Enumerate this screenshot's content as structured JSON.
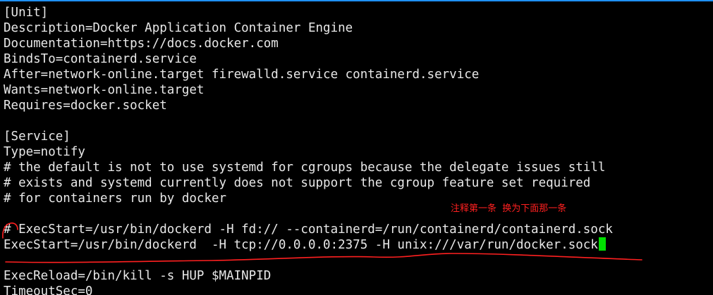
{
  "terminal": {
    "lines": [
      "[Unit]",
      "Description=Docker Application Container Engine",
      "Documentation=https://docs.docker.com",
      "BindsTo=containerd.service",
      "After=network-online.target firewalld.service containerd.service",
      "Wants=network-online.target",
      "Requires=docker.socket",
      "",
      "[Service]",
      "Type=notify",
      "# the default is not to use systemd for cgroups because the delegate issues still",
      "# exists and systemd currently does not support the cgroup feature set required",
      "# for containers run by docker",
      "",
      "# ExecStart=/usr/bin/dockerd -H fd:// --containerd=/run/containerd/containerd.sock",
      "ExecStart=/usr/bin/dockerd  -H tcp://0.0.0.0:2375 -H unix:///var/run/docker.sock",
      "",
      "ExecReload=/bin/kill -s HUP $MAINPID",
      "TimeoutSec=0"
    ],
    "cursor_color": "#00e000"
  },
  "annotation": {
    "note": "注释第一条  换为下面那一条",
    "ink_color": "#ff2020"
  }
}
